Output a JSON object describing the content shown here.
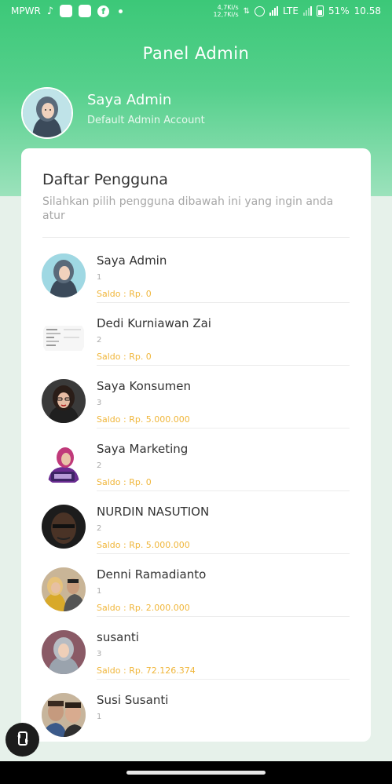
{
  "status_bar": {
    "carrier": "MPWR",
    "net_speed_up": "4,7Ki/s",
    "net_speed_down": "12,7Ki/s",
    "network": "LTE",
    "battery": "51%",
    "time": "10.58",
    "icons": [
      "tiktok-icon",
      "app-icon",
      "app-icon",
      "facebook-icon",
      "dot-icon",
      "alarm-icon",
      "signal-icon",
      "battery-icon"
    ]
  },
  "header": {
    "title": "Panel Admin",
    "profile_name": "Saya Admin",
    "profile_subtitle": "Default Admin Account"
  },
  "card": {
    "title": "Daftar Pengguna",
    "subtitle": "Silahkan pilih pengguna dibawah ini yang ingin anda atur"
  },
  "users": [
    {
      "name": "Saya Admin",
      "id": "1",
      "saldo": "Saldo : Rp. 0",
      "avatar": "hijab-woman"
    },
    {
      "name": "Dedi Kurniawan Zai",
      "id": "2",
      "saldo": "Saldo : Rp. 0",
      "avatar": "document-screenshot"
    },
    {
      "name": "Saya Konsumen",
      "id": "3",
      "saldo": "Saldo : Rp. 5.000.000",
      "avatar": "woman-glasses"
    },
    {
      "name": "Saya Marketing",
      "id": "2",
      "saldo": "Saldo : Rp. 0",
      "avatar": "hijab-purple"
    },
    {
      "name": "NURDIN NASUTION",
      "id": "2",
      "saldo": "Saldo : Rp. 5.000.000",
      "avatar": "man-dark"
    },
    {
      "name": "Denni Ramadianto",
      "id": "1",
      "saldo": "Saldo : Rp. 2.000.000",
      "avatar": "couple"
    },
    {
      "name": "susanti",
      "id": "3",
      "saldo": "Saldo : Rp. 72.126.374",
      "avatar": "hijab-woman-2"
    },
    {
      "name": "Susi Susanti",
      "id": "1",
      "saldo": "",
      "avatar": "group"
    }
  ],
  "colors": {
    "accent": "#3cc878",
    "saldo": "#f0b63a",
    "background": "#e6f1ea"
  },
  "fab_icon": "swap-icon"
}
